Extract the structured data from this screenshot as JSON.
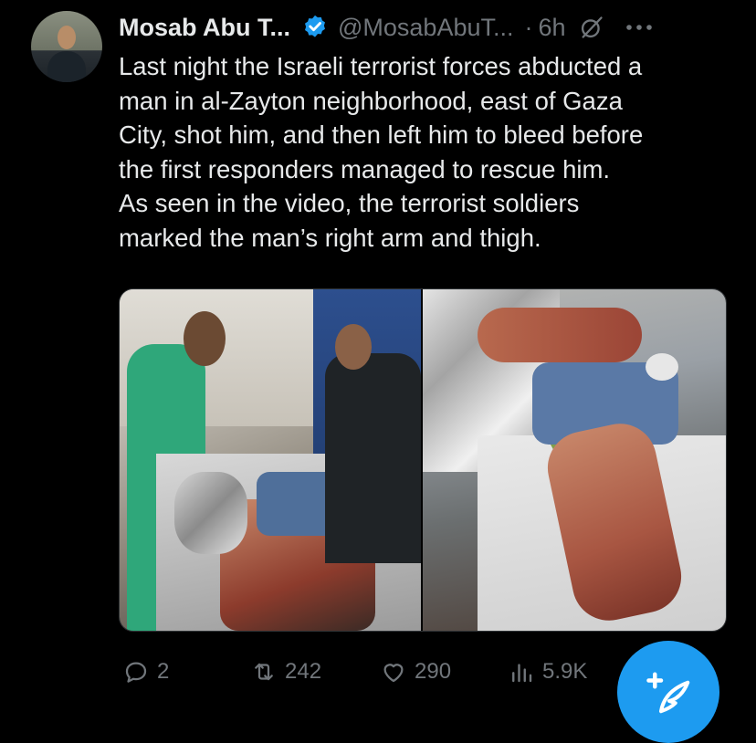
{
  "author": {
    "name": "Mosab Abu T...",
    "handle": "@MosabAbuT...",
    "separator": "·",
    "time": "6h"
  },
  "tweet": {
    "lines": [
      "Last night the Israeli terrorist forces abducted a",
      "man in al-Zayton neighborhood, east of Gaza",
      "City, shot him, and then left him to bleed before",
      "the first responders managed to rescue him.",
      "As seen in the video, the terrorist soldiers",
      "marked the man’s right arm and thigh."
    ]
  },
  "actions": {
    "replies": "2",
    "reposts": "242",
    "likes": "290",
    "views": "5.9K"
  },
  "colors": {
    "background": "#000000",
    "text": "#e7e9ea",
    "muted": "#71767b",
    "accent": "#1d9bf0"
  },
  "icons": [
    "verified-badge-icon",
    "grok-icon",
    "more-icon",
    "reply-icon",
    "repost-icon",
    "like-icon",
    "views-icon",
    "compose-icon"
  ]
}
